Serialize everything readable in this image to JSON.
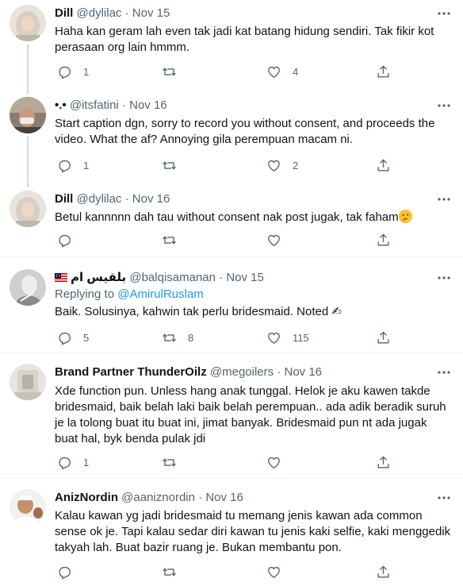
{
  "tweets": [
    {
      "name": "Dill",
      "handle": "@dylilac",
      "dot": "·",
      "date": "Nov 15",
      "text": "Haha kan geram lah even tak jadi kat batang hidung sendiri. Tak fikir kot perasaan org lain hmmm.",
      "replies": "1",
      "retweets": "",
      "likes": "4"
    },
    {
      "name": "•.•",
      "handle": "@itsfatini",
      "dot": "·",
      "date": "Nov 16",
      "text": "Start caption dgn, sorry to record you without consent, and proceeds the video. What the af? Annoying gila perempuan macam ni.",
      "replies": "1",
      "retweets": "",
      "likes": "2"
    },
    {
      "name": "Dill",
      "handle": "@dylilac",
      "dot": "·",
      "date": "Nov 16",
      "text": "Betul kannnnn dah tau without consent nak post jugak, tak faham",
      "replies": "",
      "retweets": "",
      "likes": ""
    },
    {
      "name": "بلقيس ام",
      "handle": "@balqisamanan",
      "dot": "·",
      "date": "Nov 15",
      "replying_label": "Replying to",
      "replying_to": "@AmirulRuslam",
      "text": "Baik. Solusinya, kahwin tak perlu bridesmaid. Noted ✍",
      "replies": "5",
      "retweets": "8",
      "likes": "115"
    },
    {
      "name": "Brand Partner ThunderOilz",
      "handle": "@megoilers",
      "dot": "·",
      "date": "Nov 16",
      "text": "Xde function pun. Unless hang anak tunggal. Helok je aku kawen takde bridesmaid, baik belah laki baik belah perempuan.. ada adik beradik suruh je la tolong buat itu buat ini, jimat banyak. Bridesmaid pun nt ada jugak buat hal, byk benda pulak jdi",
      "replies": "1",
      "retweets": "",
      "likes": ""
    },
    {
      "name": "AnizNordin",
      "handle": "@aaniznordin",
      "dot": "·",
      "date": "Nov 16",
      "text": "Kalau kawan yg jadi bridesmaid tu memang jenis kawan ada common sense ok je. Tapi kalau sedar diri kawan tu jenis kaki selfie, kaki menggedik takyah lah. Buat bazir ruang je. Bukan membantu pon.",
      "replies": "",
      "retweets": "",
      "likes": ""
    }
  ],
  "icons": {
    "reply": "reply-icon",
    "retweet": "retweet-icon",
    "like": "heart-icon",
    "share": "share-icon",
    "more": "more-icon",
    "flag": "malaysia-flag-icon",
    "emoji": "thinking-face-emoji"
  },
  "colors": {
    "text": "#0f1419",
    "secondary": "#536471",
    "link": "#1d9bf0",
    "divider": "#eff3f4",
    "thread_line": "#cfd9de"
  }
}
